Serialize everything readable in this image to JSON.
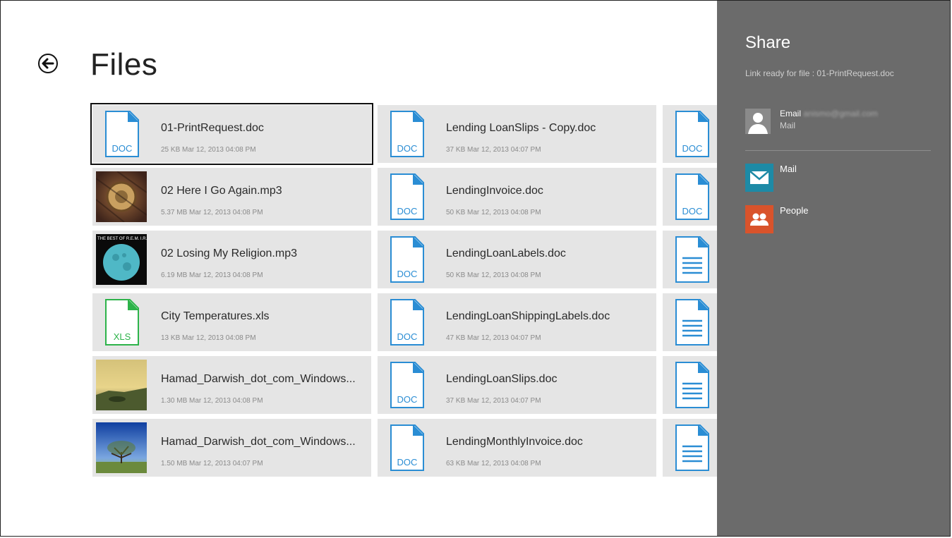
{
  "page": {
    "title": "Files"
  },
  "files": [
    {
      "name": "01-PrintRequest.doc",
      "meta": "25 KB Mar 12, 2013 04:08 PM",
      "kind": "doc",
      "label": "DOC",
      "selected": true
    },
    {
      "name": "Lending LoanSlips - Copy.doc",
      "meta": "37 KB Mar 12, 2013 04:07 PM",
      "kind": "doc",
      "label": "DOC"
    },
    {
      "name": "",
      "meta": "",
      "kind": "doc",
      "label": "DOC"
    },
    {
      "name": "02 Here I Go Again.mp3",
      "meta": "5.37 MB Mar 12, 2013 04:08 PM",
      "kind": "album-art-brown"
    },
    {
      "name": "LendingInvoice.doc",
      "meta": "50 KB Mar 12, 2013 04:08 PM",
      "kind": "doc",
      "label": "DOC"
    },
    {
      "name": "",
      "meta": "",
      "kind": "doc",
      "label": "DOC"
    },
    {
      "name": "02 Losing My Religion.mp3",
      "meta": "6.19 MB Mar 12, 2013 04:08 PM",
      "kind": "album-art-moon",
      "art_text": "THE BEST OF R.E.M. I.R.S."
    },
    {
      "name": "LendingLoanLabels.doc",
      "meta": "50 KB Mar 12, 2013 04:08 PM",
      "kind": "doc",
      "label": "DOC"
    },
    {
      "name": "",
      "meta": "",
      "kind": "text"
    },
    {
      "name": "City Temperatures.xls",
      "meta": "13 KB Mar 12, 2013 04:08 PM",
      "kind": "xls",
      "label": "XLS"
    },
    {
      "name": "LendingLoanShippingLabels.doc",
      "meta": "47 KB Mar 12, 2013 04:07 PM",
      "kind": "doc",
      "label": "DOC"
    },
    {
      "name": "",
      "meta": "",
      "kind": "text"
    },
    {
      "name": "Hamad_Darwish_dot_com_Windows...",
      "meta": "1.30 MB Mar 12, 2013 04:08 PM",
      "kind": "photo-sunset"
    },
    {
      "name": "LendingLoanSlips.doc",
      "meta": "37 KB Mar 12, 2013 04:07 PM",
      "kind": "doc",
      "label": "DOC"
    },
    {
      "name": "",
      "meta": "",
      "kind": "text"
    },
    {
      "name": "Hamad_Darwish_dot_com_Windows...",
      "meta": "1.50 MB Mar 12, 2013 04:07 PM",
      "kind": "photo-tree"
    },
    {
      "name": "LendingMonthlyInvoice.doc",
      "meta": "63 KB Mar 12, 2013 04:08 PM",
      "kind": "doc",
      "label": "DOC"
    },
    {
      "name": "",
      "meta": "",
      "kind": "text"
    }
  ],
  "share": {
    "title": "Share",
    "subtitle": "Link ready for file : 01-PrintRequest.doc",
    "contact": {
      "prefix": "Email",
      "email": "anismo@gmail.com",
      "app": "Mail"
    },
    "apps": [
      {
        "label": "Mail",
        "icon": "mail-icon",
        "color": "#1d8aa6"
      },
      {
        "label": "People",
        "icon": "people-icon",
        "color": "#d9532b"
      }
    ]
  },
  "colors": {
    "doc": "#2a8dd4",
    "xls": "#2db34a",
    "tile": "#e5e5e5",
    "panel": "#6b6b6b"
  }
}
